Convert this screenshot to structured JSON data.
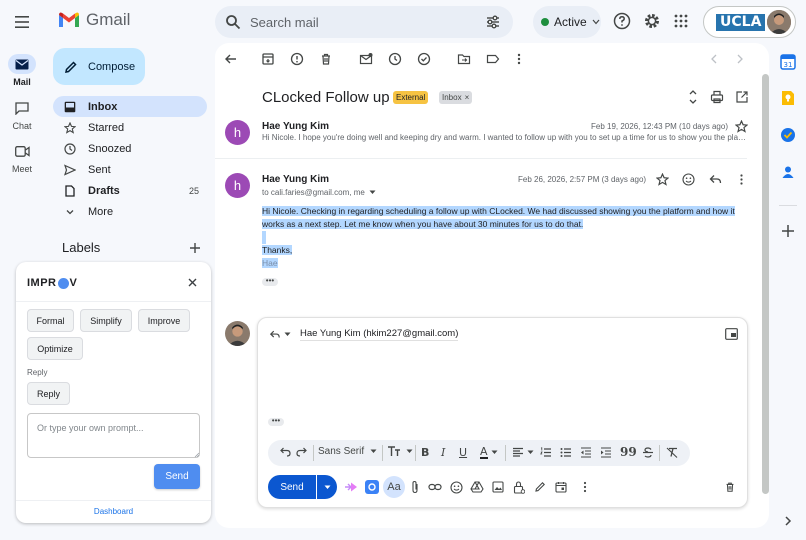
{
  "app": {
    "name": "Gmail"
  },
  "search": {
    "placeholder": "Search mail"
  },
  "status": {
    "label": "Active",
    "color": "#1e8e3e"
  },
  "account": {
    "org": "UCLA"
  },
  "rail": {
    "mail": "Mail",
    "chat": "Chat",
    "meet": "Meet"
  },
  "nav": {
    "compose": "Compose",
    "items": [
      {
        "label": "Inbox",
        "icon": "inbox-icon",
        "count": ""
      },
      {
        "label": "Starred",
        "icon": "star-icon",
        "count": ""
      },
      {
        "label": "Snoozed",
        "icon": "clock-icon",
        "count": ""
      },
      {
        "label": "Sent",
        "icon": "send-icon",
        "count": ""
      },
      {
        "label": "Drafts",
        "icon": "draft-icon",
        "count": "25"
      },
      {
        "label": "More",
        "icon": "chevron-down-icon",
        "count": ""
      }
    ],
    "labels": "Labels"
  },
  "improv": {
    "title_prefix": "IMPR",
    "title_suffix": "V",
    "buttons": [
      "Formal",
      "Simplify",
      "Improve",
      "Optimize"
    ],
    "reply_label": "Reply",
    "reply_button": "Reply",
    "prompt_placeholder": "Or type your own prompt...",
    "send": "Send",
    "dashboard": "Dashboard"
  },
  "thread": {
    "subject": "CLocked Follow up",
    "tags": [
      "External",
      "Inbox"
    ],
    "messages": [
      {
        "avatar": "h",
        "sender": "Hae Yung Kim",
        "date": "Feb 19, 2026, 12:43 PM (10 days ago)",
        "snippet": "Hi Nicole. I hope you're doing well and keeping dry and warm. I wanted to follow up with you to set up a time for us to show you the platform and how it works."
      },
      {
        "avatar": "h",
        "sender": "Hae Yung Kim",
        "to": "to cali.faries@gmail.com, me",
        "date": "Feb 26, 2026, 2:57 PM (3 days ago)",
        "body_line1": "Hi Nicole.  Checking in regarding scheduling a follow up with CLocked. We had discussed showing you the platform and how it",
        "body_line2": "works as a next step.  Let me know when you have about 30 minutes for us to do that.",
        "thanks": "Thanks,",
        "sig": "Hae"
      }
    ]
  },
  "reply": {
    "to": "Hae Yung Kim (hkim227@gmail.com)",
    "font": "Sans Serif",
    "send": "Send"
  },
  "colors": {
    "accent": "#0b57d0",
    "compose_bg": "#c2e7ff",
    "nav_active": "#d3e3fd",
    "selection": "#b3d7ff",
    "external_tag": "#f6c342",
    "avatar": "#9c4ab5"
  }
}
